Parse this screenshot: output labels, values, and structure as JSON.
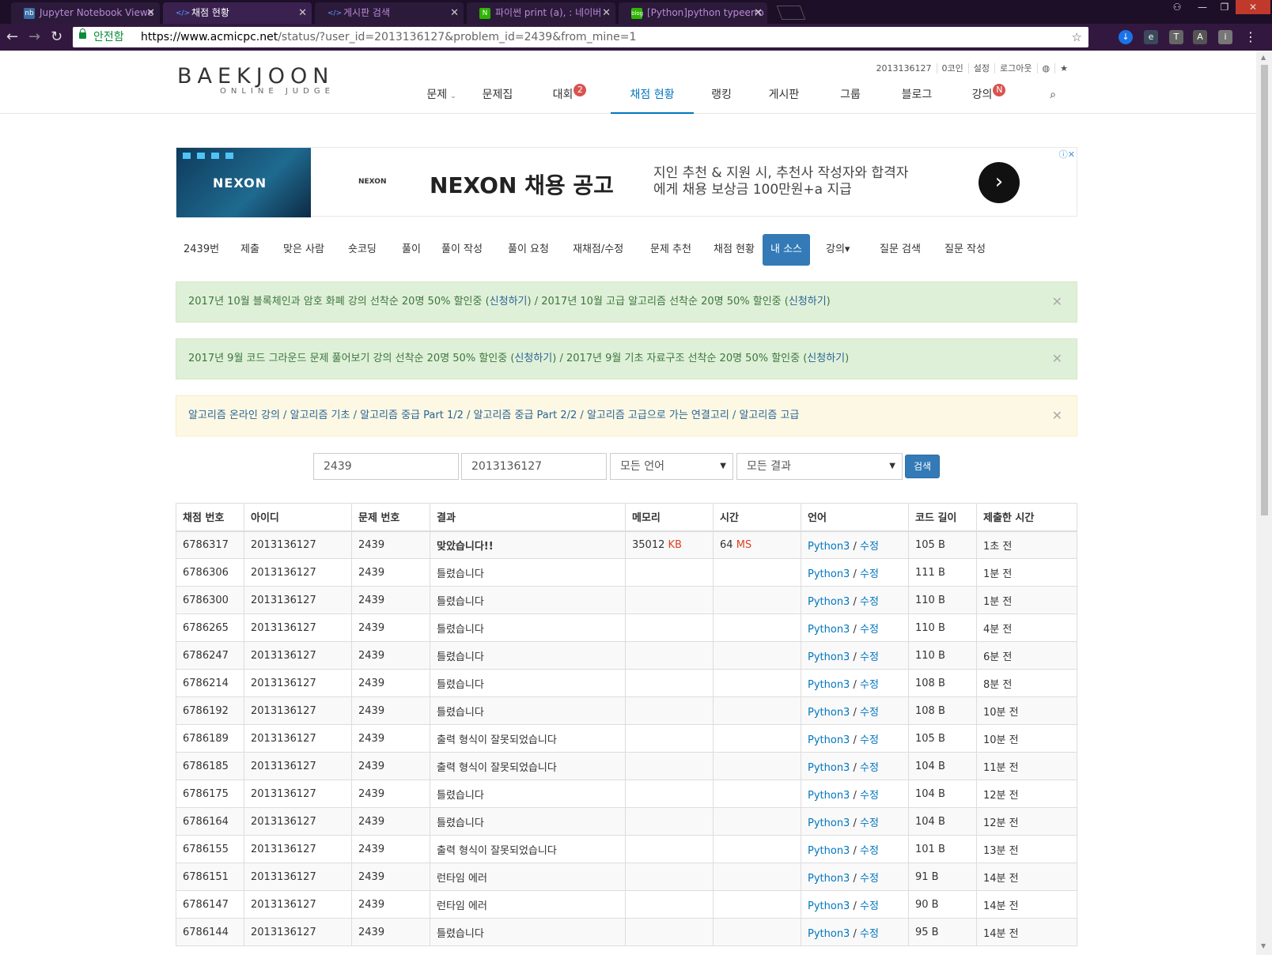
{
  "browser": {
    "tabs": [
      {
        "label": "Jupyter Notebook Viewe",
        "icon": "jupyter-icon"
      },
      {
        "label": "채점 현황",
        "icon": "boj-icon"
      },
      {
        "label": "게시판 검색",
        "icon": "boj-icon"
      },
      {
        "label": "파이썬 print (a), : 네이버",
        "icon": "naver-icon"
      },
      {
        "label": "[Python]python typeerro",
        "icon": "blog-icon"
      }
    ],
    "secure_label": "안전함",
    "url_host": "https://www.acmicpc.net",
    "url_path": "/status/?user_id=2013136127&problem_id=2439&from_mine=1"
  },
  "site": {
    "logo_main": "BAEKJOON",
    "logo_sub": "ONLINE JUDGE",
    "top_links": [
      "2013136127",
      "0코인",
      "설정",
      "로그아웃"
    ],
    "nav": [
      {
        "label": "문제",
        "caret": "⌄",
        "badge": ""
      },
      {
        "label": "문제집",
        "caret": "",
        "badge": ""
      },
      {
        "label": "대회",
        "caret": "",
        "badge": "2"
      },
      {
        "label": "채점 현황",
        "caret": "",
        "badge": ""
      },
      {
        "label": "랭킹",
        "caret": "",
        "badge": ""
      },
      {
        "label": "게시판",
        "caret": "",
        "badge": ""
      },
      {
        "label": "그룹",
        "caret": "",
        "badge": ""
      },
      {
        "label": "블로그",
        "caret": "",
        "badge": ""
      },
      {
        "label": "강의",
        "caret": "",
        "badge": "N"
      }
    ]
  },
  "ad": {
    "brand": "NEXON",
    "headline": "NEXON 채용 공고",
    "description": "지인 추천 & 지원 시, 추천사 작성자와 합격자에게 채용 보상금 100만원+a 지급"
  },
  "subnav": [
    "2439번",
    "제출",
    "맞은 사람",
    "숏코딩",
    "풀이",
    "풀이 작성",
    "풀이 요청",
    "재채점/수정",
    "문제 추천",
    "채점 현황",
    "내 소스",
    "강의▾",
    "질문 검색",
    "질문 작성"
  ],
  "alerts": [
    {
      "segments": [
        "2017년 10월 블록체인과 암호 화폐 강의 선착순 20명 50% 할인중 (",
        "신청하기",
        ") / 2017년 10월 고급 알고리즘 선착순 20명 50% 할인중 (",
        "신청하기",
        ")"
      ]
    },
    {
      "segments": [
        "2017년 9월 코드 그라운드 문제 풀어보기 강의 선착순 20명 50% 할인중 (",
        "신청하기",
        ") / 2017년 9월 기초 자료구조 선착순 20명 50% 할인중 (",
        "신청하기",
        ")"
      ]
    },
    {
      "links": [
        "알고리즘 온라인 강의",
        "알고리즘 기초",
        "알고리즘 중급 Part 1/2",
        "알고리즘 중급 Part 2/2",
        "알고리즘 고급으로 가는 연결고리",
        "알고리즘 고급"
      ]
    }
  ],
  "search": {
    "problem_id": "2439",
    "user_id": "2013136127",
    "language": "모든 언어",
    "result": "모든 결과",
    "button": "검색"
  },
  "table": {
    "headers": [
      "채점 번호",
      "아이디",
      "문제 번호",
      "결과",
      "메모리",
      "시간",
      "언어",
      "코드 길이",
      "제출한 시간"
    ],
    "rows": [
      {
        "id": "6786317",
        "user": "2013136127",
        "problem": "2439",
        "result": "맞았습니다!!",
        "status": "ac",
        "memory": "35012",
        "memory_unit": "KB",
        "time": "64",
        "time_unit": "MS",
        "lang": "Python3",
        "edit": "수정",
        "length": "105 B",
        "submitted": "1초 전"
      },
      {
        "id": "6786306",
        "user": "2013136127",
        "problem": "2439",
        "result": "틀렸습니다",
        "status": "wa",
        "memory": "",
        "memory_unit": "",
        "time": "",
        "time_unit": "",
        "lang": "Python3",
        "edit": "수정",
        "length": "111 B",
        "submitted": "1분 전"
      },
      {
        "id": "6786300",
        "user": "2013136127",
        "problem": "2439",
        "result": "틀렸습니다",
        "status": "wa",
        "memory": "",
        "memory_unit": "",
        "time": "",
        "time_unit": "",
        "lang": "Python3",
        "edit": "수정",
        "length": "110 B",
        "submitted": "1분 전"
      },
      {
        "id": "6786265",
        "user": "2013136127",
        "problem": "2439",
        "result": "틀렸습니다",
        "status": "wa",
        "memory": "",
        "memory_unit": "",
        "time": "",
        "time_unit": "",
        "lang": "Python3",
        "edit": "수정",
        "length": "110 B",
        "submitted": "4분 전"
      },
      {
        "id": "6786247",
        "user": "2013136127",
        "problem": "2439",
        "result": "틀렸습니다",
        "status": "wa",
        "memory": "",
        "memory_unit": "",
        "time": "",
        "time_unit": "",
        "lang": "Python3",
        "edit": "수정",
        "length": "110 B",
        "submitted": "6분 전"
      },
      {
        "id": "6786214",
        "user": "2013136127",
        "problem": "2439",
        "result": "틀렸습니다",
        "status": "wa",
        "memory": "",
        "memory_unit": "",
        "time": "",
        "time_unit": "",
        "lang": "Python3",
        "edit": "수정",
        "length": "108 B",
        "submitted": "8분 전"
      },
      {
        "id": "6786192",
        "user": "2013136127",
        "problem": "2439",
        "result": "틀렸습니다",
        "status": "wa",
        "memory": "",
        "memory_unit": "",
        "time": "",
        "time_unit": "",
        "lang": "Python3",
        "edit": "수정",
        "length": "108 B",
        "submitted": "10분 전"
      },
      {
        "id": "6786189",
        "user": "2013136127",
        "problem": "2439",
        "result": "출력 형식이 잘못되었습니다",
        "status": "pe",
        "memory": "",
        "memory_unit": "",
        "time": "",
        "time_unit": "",
        "lang": "Python3",
        "edit": "수정",
        "length": "105 B",
        "submitted": "10분 전"
      },
      {
        "id": "6786185",
        "user": "2013136127",
        "problem": "2439",
        "result": "출력 형식이 잘못되었습니다",
        "status": "pe",
        "memory": "",
        "memory_unit": "",
        "time": "",
        "time_unit": "",
        "lang": "Python3",
        "edit": "수정",
        "length": "104 B",
        "submitted": "11분 전"
      },
      {
        "id": "6786175",
        "user": "2013136127",
        "problem": "2439",
        "result": "틀렸습니다",
        "status": "wa",
        "memory": "",
        "memory_unit": "",
        "time": "",
        "time_unit": "",
        "lang": "Python3",
        "edit": "수정",
        "length": "104 B",
        "submitted": "12분 전"
      },
      {
        "id": "6786164",
        "user": "2013136127",
        "problem": "2439",
        "result": "틀렸습니다",
        "status": "wa",
        "memory": "",
        "memory_unit": "",
        "time": "",
        "time_unit": "",
        "lang": "Python3",
        "edit": "수정",
        "length": "104 B",
        "submitted": "12분 전"
      },
      {
        "id": "6786155",
        "user": "2013136127",
        "problem": "2439",
        "result": "출력 형식이 잘못되었습니다",
        "status": "pe",
        "memory": "",
        "memory_unit": "",
        "time": "",
        "time_unit": "",
        "lang": "Python3",
        "edit": "수정",
        "length": "101 B",
        "submitted": "13분 전"
      },
      {
        "id": "6786151",
        "user": "2013136127",
        "problem": "2439",
        "result": "런타임 에러",
        "status": "rte",
        "memory": "",
        "memory_unit": "",
        "time": "",
        "time_unit": "",
        "lang": "Python3",
        "edit": "수정",
        "length": "91 B",
        "submitted": "14분 전"
      },
      {
        "id": "6786147",
        "user": "2013136127",
        "problem": "2439",
        "result": "런타임 에러",
        "status": "rte",
        "memory": "",
        "memory_unit": "",
        "time": "",
        "time_unit": "",
        "lang": "Python3",
        "edit": "수정",
        "length": "90 B",
        "submitted": "14분 전"
      },
      {
        "id": "6786144",
        "user": "2013136127",
        "problem": "2439",
        "result": "틀렸습니다",
        "status": "wa",
        "memory": "",
        "memory_unit": "",
        "time": "",
        "time_unit": "",
        "lang": "Python3",
        "edit": "수정",
        "length": "95 B",
        "submitted": "14분 전"
      }
    ]
  },
  "colors": {
    "link": "#0076c0",
    "accepted": "#009874",
    "wrong": "#dd4124",
    "runtime_error": "#1a5fa0",
    "alert_green_bg": "#dff0d8",
    "alert_yellow_bg": "#fcf8e3",
    "primary_button": "#337ab7"
  }
}
